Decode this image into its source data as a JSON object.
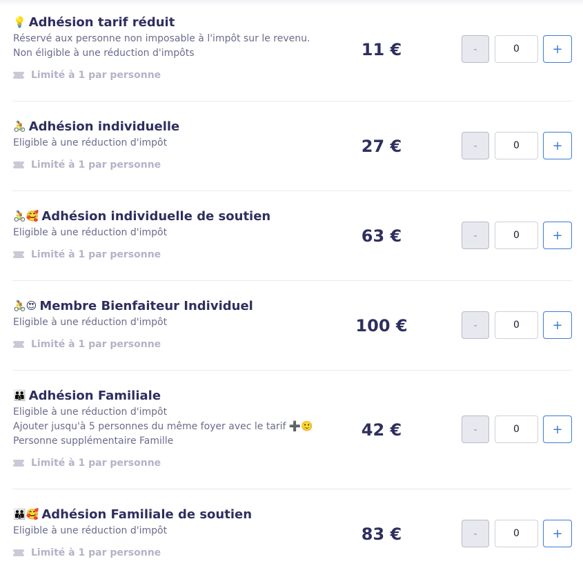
{
  "tiers": [
    {
      "emoji": "💡",
      "title": "Adhésion tarif réduit",
      "desc": [
        "Réservé aux personne non imposable à l'impôt sur le revenu.",
        "Non éligible à une réduction d'impôts"
      ],
      "limit": "Limité à 1 par personne",
      "price": "11 €",
      "minus": "-",
      "qty": "0",
      "plus": "+"
    },
    {
      "emoji": "🚴",
      "title": "Adhésion individuelle",
      "desc": [
        "Eligible à une réduction d'impôt"
      ],
      "limit": "Limité à 1 par personne",
      "price": "27 €",
      "minus": "-",
      "qty": "0",
      "plus": "+"
    },
    {
      "emoji": "🚴🥰",
      "title": "Adhésion individuelle de soutien",
      "desc": [
        "Eligible à une réduction d'impôt"
      ],
      "limit": "Limité à 1 par personne",
      "price": "63 €",
      "minus": "-",
      "qty": "0",
      "plus": "+"
    },
    {
      "emoji": "🚴😍",
      "title": "Membre Bienfaiteur Individuel",
      "desc": [
        "Eligible à une réduction d'impôt"
      ],
      "limit": "Limité à 1 par personne",
      "price": "100 €",
      "minus": "-",
      "qty": "0",
      "plus": "+"
    },
    {
      "emoji": "👪",
      "title": "Adhésion Familiale",
      "desc": [
        "Eligible à une réduction d'impôt",
        "Ajouter jusqu'à 5 personnes du même foyer avec le tarif ➕🙂",
        "Personne supplémentaire Famille"
      ],
      "limit": "Limité à 1 par personne",
      "price": "42 €",
      "minus": "-",
      "qty": "0",
      "plus": "+"
    },
    {
      "emoji": "👪🥰",
      "title": "Adhésion Familiale de soutien",
      "desc": [
        "Eligible à une réduction d'impôt"
      ],
      "limit": "Limité à 1 par personne",
      "price": "83 €",
      "minus": "-",
      "qty": "0",
      "plus": "+"
    }
  ],
  "colors": {
    "title": "#2e2f5e",
    "desc": "#6a6b8c",
    "limit": "#b3b3c7",
    "plus_accent": "#3a7bd5",
    "minus_bg": "#e8e8ef"
  }
}
